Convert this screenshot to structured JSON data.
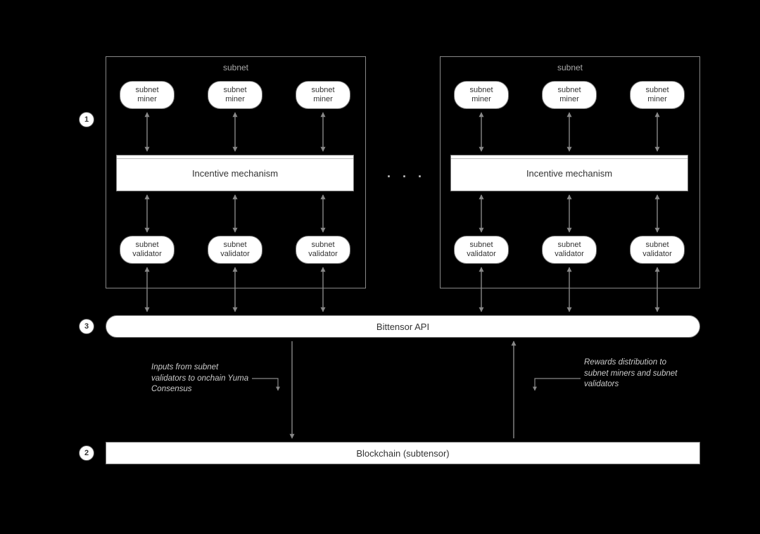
{
  "badges": {
    "one": "1",
    "two": "2",
    "three": "3"
  },
  "subnet": {
    "title": "subnet",
    "miner": "subnet\nminer",
    "validator": "subnet\nvalidator",
    "incentive": "Incentive mechanism"
  },
  "ellipsis": ". . .",
  "api": "Bittensor API",
  "blockchain": "Blockchain (subtensor)",
  "flows": {
    "inputs": "Inputs from subnet validators to onchain Yuma Consensus",
    "rewards": "Rewards distribution to subnet miners and subnet validators"
  }
}
